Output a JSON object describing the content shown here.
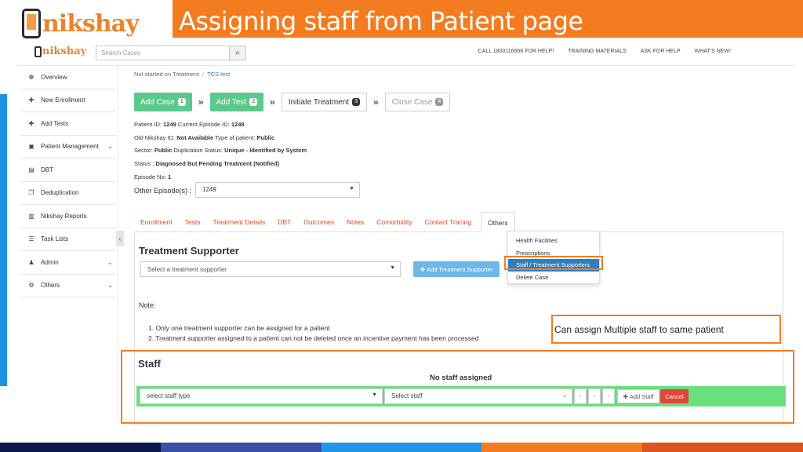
{
  "slide": {
    "title": "Assigning staff from Patient page",
    "logo_text": "nikshay",
    "callout": "Can assign Multiple staff to same patient"
  },
  "header": {
    "logo_text": "nikshay",
    "search_placeholder": "Search Cases",
    "links": [
      "CALL 1800116666 FOR HELP!",
      "TRAINING MATERIALS",
      "ASK FOR HELP",
      "WHAT'S NEW!"
    ]
  },
  "sidebar": {
    "items": [
      {
        "label": "Overview",
        "icon": "dashboard-icon",
        "glyph": "❁"
      },
      {
        "label": "New Enrollment",
        "icon": "plus-icon",
        "glyph": "✚"
      },
      {
        "label": "Add Tests",
        "icon": "plus-icon",
        "glyph": "✚"
      },
      {
        "label": "Patient Management",
        "icon": "briefcase-icon",
        "glyph": "▣",
        "chevron": true
      },
      {
        "label": "DBT",
        "icon": "money-icon",
        "glyph": "▤"
      },
      {
        "label": "Deduplication",
        "icon": "copy-icon",
        "glyph": "❐"
      },
      {
        "label": "Nikshay Reports",
        "icon": "report-icon",
        "glyph": "▥"
      },
      {
        "label": "Task Lists",
        "icon": "list-icon",
        "glyph": "☰"
      },
      {
        "label": "Admin",
        "icon": "user-icon",
        "glyph": "♟",
        "chevron": true
      },
      {
        "label": "Others",
        "icon": "gear-icon",
        "glyph": "⚙",
        "chevron": true
      }
    ]
  },
  "breadcrumb": {
    "first": "Not started on Treatment",
    "second": "TCS test"
  },
  "steps": [
    {
      "label": "Add Case",
      "num": "1",
      "style": "green"
    },
    {
      "label": "Add Test",
      "num": "2",
      "style": "green"
    },
    {
      "label": "Initiate Treatment",
      "num": "3",
      "style": "outline"
    },
    {
      "label": "Close Case",
      "num": "4",
      "style": "outline gray"
    }
  ],
  "patient": {
    "patient_id_label": "Patient ID:",
    "patient_id": "1249",
    "episode_id_label": "Current Episode ID:",
    "episode_id": "1249",
    "old_id_label": "Old Nikshay ID:",
    "old_id": "Not Available",
    "type_label": "Type of patient:",
    "type": "Public",
    "sector_label": "Sector:",
    "sector": "Public",
    "dup_label": "Duplication Status:",
    "dup": "Unique - Identified by System",
    "status_label": "Status :",
    "status": "Diagnosed But Pending Treatment (Notified)",
    "episode_no_label": "Episode No:",
    "episode_no": "1",
    "other_episodes_label": "Other Episode(s) :",
    "other_episodes_value": "1249"
  },
  "tabs": [
    "Enrollment",
    "Tests",
    "Treatment Details",
    "DBT",
    "Outcomes",
    "Notes",
    "Comorbidity",
    "Contact Tracing",
    "Others"
  ],
  "others_menu": [
    "Health Facilities",
    "Prescriptions",
    "Staff / Treatment Supporters",
    "Delete Case"
  ],
  "treatment_supporter": {
    "title": "Treatment Supporter",
    "select_placeholder": "Select a treatment supporter",
    "add_button": "Add Treatment Supporter",
    "note_title": "Note:",
    "notes": [
      "1. Only one treatment supporter can be assigned for a patient",
      "2. Treatment supporter assigned to a patient can not be deleted once an incentive payment has been processed"
    ]
  },
  "staff": {
    "title": "Staff",
    "empty": "No staff assigned",
    "type_placeholder": "select staff type",
    "staff_placeholder": "Select staff",
    "dash": "-",
    "add_button": "Add Staff",
    "cancel_button": "Cancel"
  },
  "colors": {
    "accent": "#f47c20",
    "green": "#5bc98b",
    "row_green": "#68e07f",
    "link_red": "#e0461c",
    "blue": "#2d7fc1",
    "bottom": [
      "#0b1a4a",
      "#3a4fa8",
      "#2196e8",
      "#f47c20",
      "#d9541f"
    ]
  }
}
